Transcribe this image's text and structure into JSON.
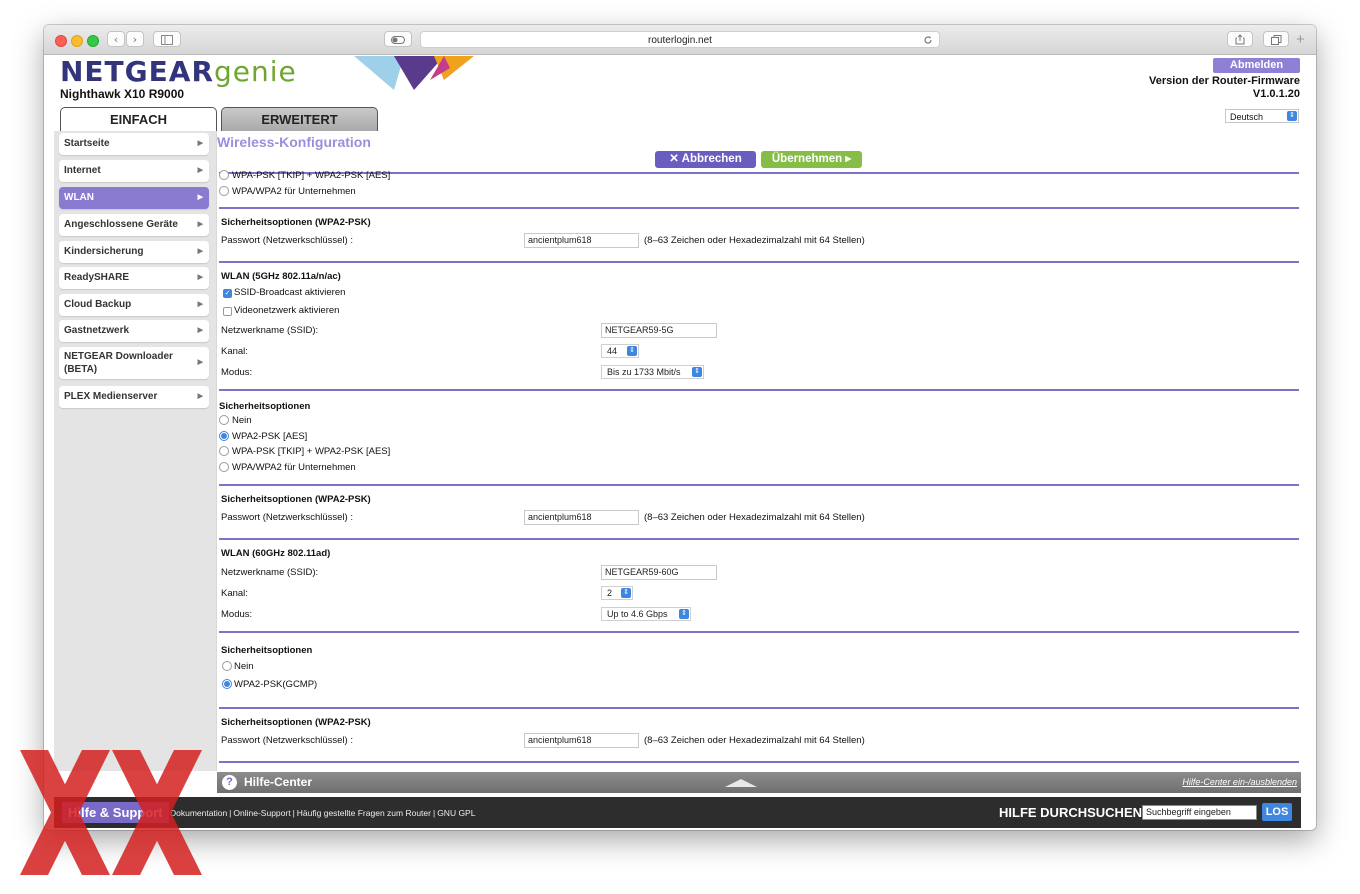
{
  "browser": {
    "url": "routerlogin.net",
    "back_glyph": "‹",
    "forward_glyph": "›"
  },
  "header": {
    "brand": "NETGEAR",
    "brand_suffix": "genie",
    "model": "Nighthawk X10 R9000",
    "logout_label": "Abmelden",
    "firmware_label": "Version der Router-Firmware",
    "firmware_version": "V1.0.1.20",
    "language": "Deutsch"
  },
  "tabs": {
    "simple": "EINFACH",
    "advanced": "ERWEITERT"
  },
  "sidebar": {
    "items": [
      {
        "label": "Startseite"
      },
      {
        "label": "Internet"
      },
      {
        "label": "WLAN"
      },
      {
        "label": "Angeschlossene Geräte"
      },
      {
        "label": "Kindersicherung"
      },
      {
        "label": "ReadySHARE"
      },
      {
        "label": "Cloud Backup"
      },
      {
        "label": "Gastnetzwerk"
      },
      {
        "label": "NETGEAR Downloader (BETA)"
      },
      {
        "label": "PLEX Medienserver"
      }
    ]
  },
  "page": {
    "title": "Wireless-Konfiguration",
    "cancel_label": "Abbrechen",
    "apply_label": "Übernehmen"
  },
  "form": {
    "top_options": [
      "WPA-PSK [TKIP] + WPA2-PSK [AES]",
      "WPA/WPA2 für Unternehmen"
    ],
    "sec1_title": "Sicherheitsoptionen (WPA2-PSK)",
    "password_label": "Passwort (Netzwerkschlüssel) :",
    "password_value": "ancientplum618",
    "password_hint": "(8–63 Zeichen oder Hexadezimalzahl mit 64 Stellen)",
    "wlan5_title": "WLAN (5GHz 802.11a/n/ac)",
    "ssid_broadcast": "SSID-Broadcast aktivieren",
    "video_network": "Videonetzwerk aktivieren",
    "ssid_label": "Netzwerkname (SSID):",
    "ssid5_value": "NETGEAR59-5G",
    "channel_label": "Kanal:",
    "channel5_value": "44",
    "mode_label": "Modus:",
    "mode5_value": "Bis zu 1733 Mbit/s",
    "sec_options_title": "Sicherheitsoptionen",
    "opt_none": "Nein",
    "opt_wpa2_aes": "WPA2-PSK [AES]",
    "opt_mixed": "WPA-PSK [TKIP] + WPA2-PSK [AES]",
    "opt_enterprise": "WPA/WPA2 für Unternehmen",
    "wlan60_title": "WLAN (60GHz 802.11ad)",
    "ssid60_value": "NETGEAR59-60G",
    "channel60_value": "2",
    "mode60_value": "Up to 4.6 Gbps",
    "opt_gcmp": "WPA2-PSK(GCMP)"
  },
  "help": {
    "title": "Hilfe-Center",
    "toggle_link": "Hilfe-Center ein-/ausblenden"
  },
  "footer": {
    "help_support": "Hilfe & Support",
    "links": [
      "Dokumentation",
      "Online-Support",
      "Häufig gestellte Fragen zum Router",
      "GNU GPL"
    ],
    "search_title": "HILFE DURCHSUCHEN",
    "search_placeholder": "Suchbegriff eingeben",
    "search_button": "LOS"
  },
  "colors": {
    "brand": "#32357b",
    "genie": "#6fa632",
    "accent": "#8a7ad0",
    "apply": "#85bd47",
    "watermark": "#d42020"
  }
}
